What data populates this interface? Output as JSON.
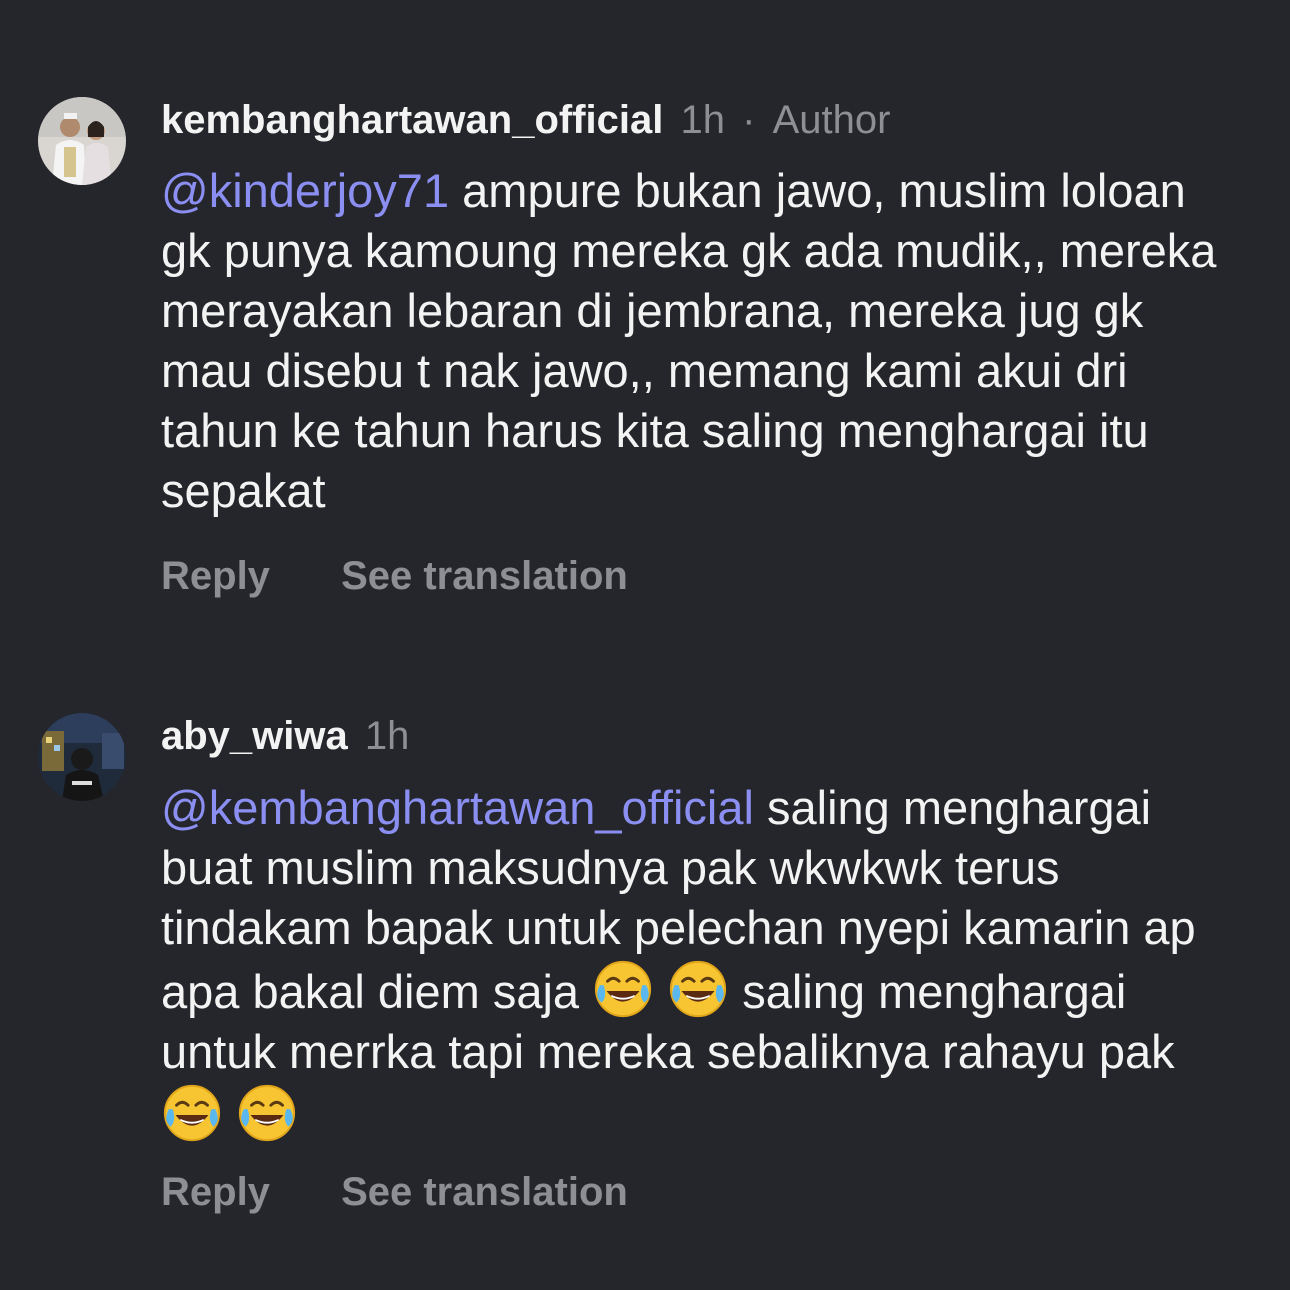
{
  "comments": [
    {
      "username": "kembanghartawan_official",
      "time": "1h",
      "separator": "·",
      "badge": "Author",
      "mention": "@kinderjoy71",
      "text_parts": [
        "ampure bukan jawo, muslim loloan gk punya kamoung mereka gk ada mudik,, mereka merayakan lebaran di jembrana, mereka jug gk mau disebu t nak jawo,, memang kami akui dri tahun ke tahun harus kita saling menghargai itu sepakat"
      ],
      "reply_label": "Reply",
      "translate_label": "See translation"
    },
    {
      "username": "aby_wiwa",
      "time": "1h",
      "mention": "@kembanghartawan_official",
      "text_parts": [
        "saling menghargai buat muslim maksudnya pak wkwkwk  terus tindakam bapak untuk pelechan nyepi kamarin ap apa bakal diem saja",
        "saling menghargai untuk merrka tapi mereka sebaliknya rahayu pak"
      ],
      "emojis": [
        "face-with-tears-of-joy-icon",
        "face-with-tears-of-joy-icon",
        "face-with-tears-of-joy-icon",
        "face-with-tears-of-joy-icon"
      ],
      "reply_label": "Reply",
      "translate_label": "See translation"
    }
  ],
  "colors": {
    "background": "#25262b",
    "mention": "#8b8ff2",
    "muted": "#8e8f94",
    "text": "#f3f3f3"
  }
}
